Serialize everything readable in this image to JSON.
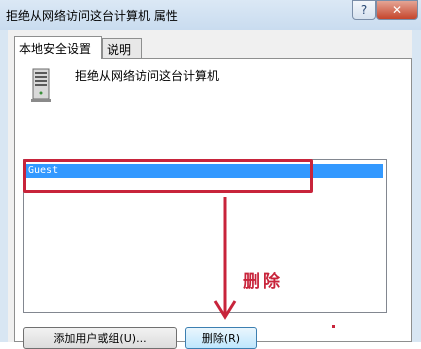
{
  "window": {
    "title": "拒绝从网络访问这台计算机 属性",
    "help_label": "?",
    "close_label": "✕"
  },
  "tabs": [
    {
      "label": "本地安全设置",
      "active": true
    },
    {
      "label": "说明",
      "active": false
    }
  ],
  "policy": {
    "icon": "server-computer-icon",
    "title": "拒绝从网络访问这台计算机"
  },
  "list": {
    "items": [
      {
        "label": "Guest",
        "selected": true
      }
    ]
  },
  "buttons": {
    "add_label": "添加用户或组(U)...",
    "remove_label": "删除(R)"
  },
  "annotation": {
    "text": "删除",
    "color": "#c8243b"
  },
  "colors": {
    "selection": "#3399ff",
    "annotation_red": "#c8243b",
    "titlebar": "#d8e6f3"
  }
}
